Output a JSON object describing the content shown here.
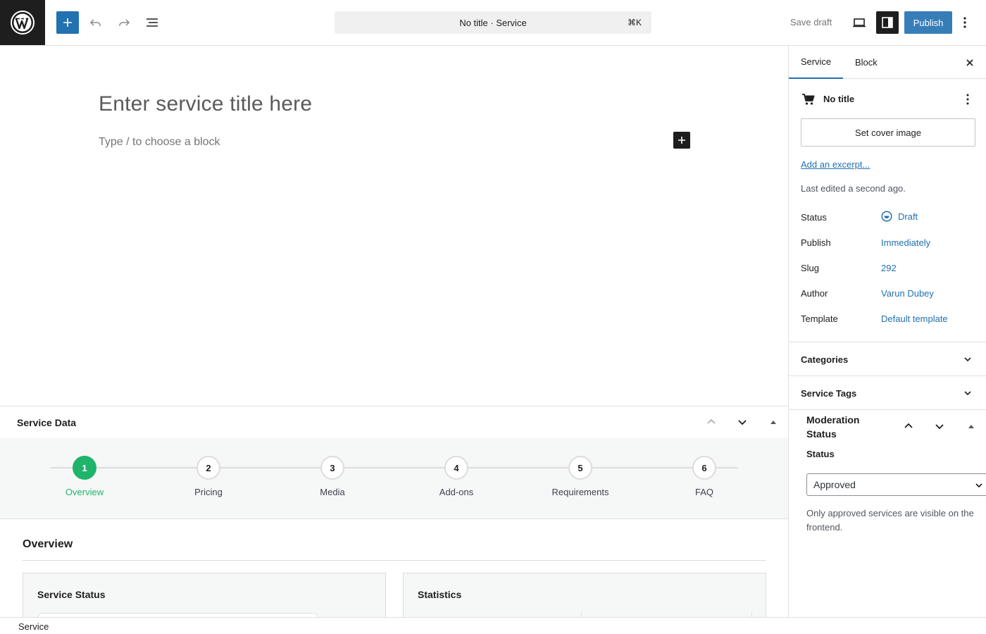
{
  "header": {
    "command_bar_text": "No title · Service",
    "command_shortcut": "⌘K",
    "save_draft_label": "Save draft",
    "publish_label": "Publish"
  },
  "editor": {
    "title_placeholder": "Enter service title here",
    "block_placeholder": "Type / to choose a block"
  },
  "metabox": {
    "title": "Service Data",
    "steps": [
      {
        "number": "1",
        "label": "Overview",
        "active": true
      },
      {
        "number": "2",
        "label": "Pricing",
        "active": false
      },
      {
        "number": "3",
        "label": "Media",
        "active": false
      },
      {
        "number": "4",
        "label": "Add-ons",
        "active": false
      },
      {
        "number": "5",
        "label": "Requirements",
        "active": false
      },
      {
        "number": "6",
        "label": "FAQ",
        "active": false
      }
    ],
    "section_title": "Overview",
    "cards": [
      {
        "title": "Service Status"
      },
      {
        "title": "Statistics"
      }
    ]
  },
  "sidebar": {
    "tabs": [
      {
        "label": "Service",
        "active": true
      },
      {
        "label": "Block",
        "active": false
      }
    ],
    "post_title": "No title",
    "cover_image_label": "Set cover image",
    "excerpt_link": "Add an excerpt...",
    "last_edited": "Last edited a second ago.",
    "meta": {
      "status": {
        "label": "Status",
        "value": "Draft"
      },
      "publish": {
        "label": "Publish",
        "value": "Immediately"
      },
      "slug": {
        "label": "Slug",
        "value": "292"
      },
      "author": {
        "label": "Author",
        "value": "Varun Dubey"
      },
      "template": {
        "label": "Template",
        "value": "Default template"
      }
    },
    "sections": [
      {
        "title": "Categories"
      },
      {
        "title": "Service Tags"
      }
    ],
    "moderation": {
      "title": "Moderation Status",
      "status_label": "Status",
      "selected": "Approved",
      "help": "Only approved services are visible on the frontend."
    }
  },
  "footer": {
    "breadcrumb": "Service"
  },
  "colors": {
    "accent": "#2271b1",
    "success": "#1fb46a",
    "dark": "#1e1e1e"
  }
}
